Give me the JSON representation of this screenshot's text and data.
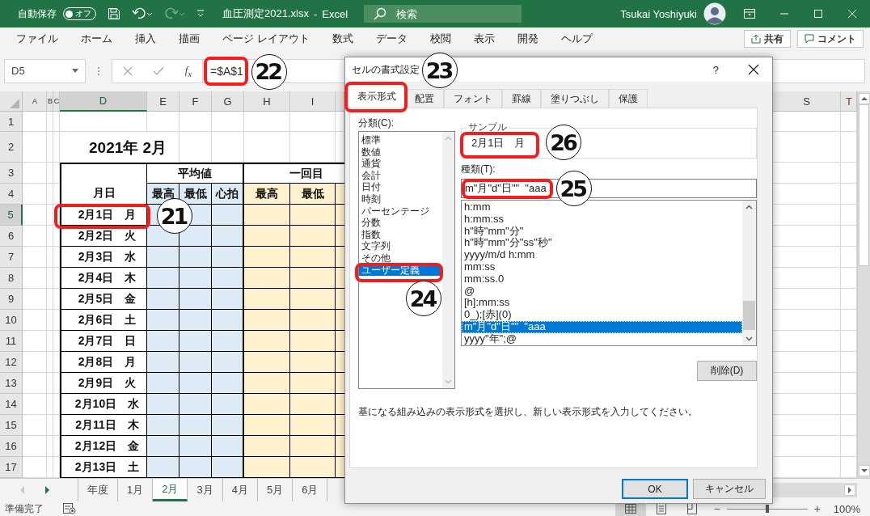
{
  "title_bar": {
    "autosave_label": "自動保存",
    "autosave_state": "オフ",
    "autosave_on": false,
    "document": "血圧測定2021.xlsx",
    "separator": "-",
    "app": "Excel",
    "search_placeholder": "検索",
    "user": "Tsukai Yoshiyuki"
  },
  "ribbon": {
    "tabs": [
      "ファイル",
      "ホーム",
      "挿入",
      "描画",
      "ページ レイアウト",
      "数式",
      "データ",
      "校閲",
      "表示",
      "開発",
      "ヘルプ"
    ],
    "share": "共有",
    "comment": "コメント"
  },
  "formula_bar": {
    "name_box": "D5",
    "insert_function": "f$_{x}$",
    "formula": "=$A$1",
    "framed": true,
    "callout": "22"
  },
  "sheet": {
    "columns": [
      {
        "label": "A",
        "selected": false
      },
      {
        "label": "B",
        "selected": false
      },
      {
        "label": "C",
        "selected": false
      },
      {
        "label": "D",
        "selected": true
      },
      {
        "label": "E",
        "selected": false
      },
      {
        "label": "F",
        "selected": false
      },
      {
        "label": "G",
        "selected": false
      },
      {
        "label": "H",
        "selected": false
      },
      {
        "label": "I",
        "selected": false
      }
    ],
    "columns_right": [
      {
        "label": "S",
        "selected": false
      },
      {
        "label": "T",
        "selected": false
      }
    ],
    "rows": [
      {
        "label": "1",
        "selected": false
      },
      {
        "label": "2",
        "selected": false
      },
      {
        "label": "3",
        "selected": false
      },
      {
        "label": "4",
        "selected": false
      },
      {
        "label": "5",
        "selected": true
      },
      {
        "label": "6",
        "selected": false
      },
      {
        "label": "7",
        "selected": false
      },
      {
        "label": "8",
        "selected": false
      },
      {
        "label": "9",
        "selected": false
      },
      {
        "label": "10",
        "selected": false
      },
      {
        "label": "11",
        "selected": false
      },
      {
        "label": "12",
        "selected": false
      },
      {
        "label": "13",
        "selected": false
      },
      {
        "label": "14",
        "selected": false
      },
      {
        "label": "15",
        "selected": false
      },
      {
        "label": "16",
        "selected": false
      },
      {
        "label": "17",
        "selected": false
      }
    ],
    "title": "2021年 2月",
    "table": {
      "corner_header": "月日",
      "groups": [
        {
          "label": "平均値",
          "color": "#ddebf7",
          "columns": [
            "最高",
            "最低",
            "心拍"
          ]
        },
        {
          "label": "一回目",
          "color": "#fff2cc",
          "columns": [
            "最高",
            "最低"
          ]
        }
      ],
      "rows": [
        {
          "date": "2月1日　月",
          "framed": true,
          "callout": "21"
        },
        {
          "date": "2月2日　火",
          "framed": false
        },
        {
          "date": "2月3日　水",
          "framed": false
        },
        {
          "date": "2月4日　木",
          "framed": false
        },
        {
          "date": "2月5日　金",
          "framed": false
        },
        {
          "date": "2月6日　土",
          "framed": false
        },
        {
          "date": "2月7日　日",
          "framed": false
        },
        {
          "date": "2月8日　月",
          "framed": false
        },
        {
          "date": "2月9日　火",
          "framed": false
        },
        {
          "date": "2月10日　水",
          "framed": false
        },
        {
          "date": "2月11日　木",
          "framed": false
        },
        {
          "date": "2月12日　金",
          "framed": false
        },
        {
          "date": "2月13日　土",
          "framed": false
        }
      ]
    }
  },
  "sheet_tabs": [
    {
      "label": "年度",
      "selected": false
    },
    {
      "label": "1月",
      "selected": false
    },
    {
      "label": "2月",
      "selected": true
    },
    {
      "label": "3月",
      "selected": false
    },
    {
      "label": "4月",
      "selected": false
    },
    {
      "label": "5月",
      "selected": false
    },
    {
      "label": "6月",
      "selected": false
    }
  ],
  "status_bar": {
    "status": "準備完了",
    "views": [
      {
        "kind": "normal",
        "selected": true
      },
      {
        "kind": "page_layout",
        "selected": false
      },
      {
        "kind": "page_break",
        "selected": false
      }
    ],
    "zoom_out": "−",
    "zoom_in": "+",
    "zoom": {
      "level": 0.5,
      "label": "100%"
    }
  },
  "dialog": {
    "title": "セルの書式設定",
    "help": "?",
    "tabs": [
      {
        "label": "表示形式",
        "selected": true,
        "framed": true,
        "callout": "23"
      },
      {
        "label": "配置",
        "selected": false,
        "framed": false
      },
      {
        "label": "フォント",
        "selected": false,
        "framed": false
      },
      {
        "label": "罫線",
        "selected": false,
        "framed": false
      },
      {
        "label": "塗りつぶし",
        "selected": false,
        "framed": false
      },
      {
        "label": "保護",
        "selected": false,
        "framed": false
      }
    ],
    "category_label": "分類(C):",
    "categories": [
      {
        "label": "標準",
        "selected": false,
        "framed": false
      },
      {
        "label": "数値",
        "selected": false,
        "framed": false
      },
      {
        "label": "通貨",
        "selected": false,
        "framed": false
      },
      {
        "label": "会計",
        "selected": false,
        "framed": false
      },
      {
        "label": "日付",
        "selected": false,
        "framed": false
      },
      {
        "label": "時刻",
        "selected": false,
        "framed": false
      },
      {
        "label": "パーセンテージ",
        "selected": false,
        "framed": false
      },
      {
        "label": "分数",
        "selected": false,
        "framed": false
      },
      {
        "label": "指数",
        "selected": false,
        "framed": false
      },
      {
        "label": "文字列",
        "selected": false,
        "framed": false
      },
      {
        "label": "その他",
        "selected": false,
        "framed": false
      },
      {
        "label": "ユーザー定義",
        "selected": true,
        "framed": true,
        "callout": "24"
      }
    ],
    "sample_label": "サンプル",
    "sample": {
      "text": "2月1日　月",
      "framed": true,
      "callout": "26"
    },
    "type_label": "種類(T):",
    "type_field": {
      "value": "m\"月\"d\"日\"\"  \"aaa",
      "framed": true,
      "callout": "25"
    },
    "formats": [
      {
        "label": "h:mm",
        "selected": false
      },
      {
        "label": "h:mm:ss",
        "selected": false
      },
      {
        "label": "h\"時\"mm\"分\"",
        "selected": false
      },
      {
        "label": "h\"時\"mm\"分\"ss\"秒\"",
        "selected": false
      },
      {
        "label": "yyyy/m/d h:mm",
        "selected": false
      },
      {
        "label": "mm:ss",
        "selected": false
      },
      {
        "label": "mm:ss.0",
        "selected": false
      },
      {
        "label": "@",
        "selected": false
      },
      {
        "label": "[h]:mm:ss",
        "selected": false
      },
      {
        "label": "0_);[赤](0)",
        "selected": false
      },
      {
        "label": "m\"月\"d\"日\"\"  \"aaa",
        "selected": true
      },
      {
        "label": "yyyy\"年\";@",
        "selected": false
      }
    ],
    "delete_button": "削除(D)",
    "description": "基になる組み込みの表示形式を選択し、新しい表示形式を入力してください。",
    "ok": "OK",
    "cancel": "キャンセル"
  }
}
